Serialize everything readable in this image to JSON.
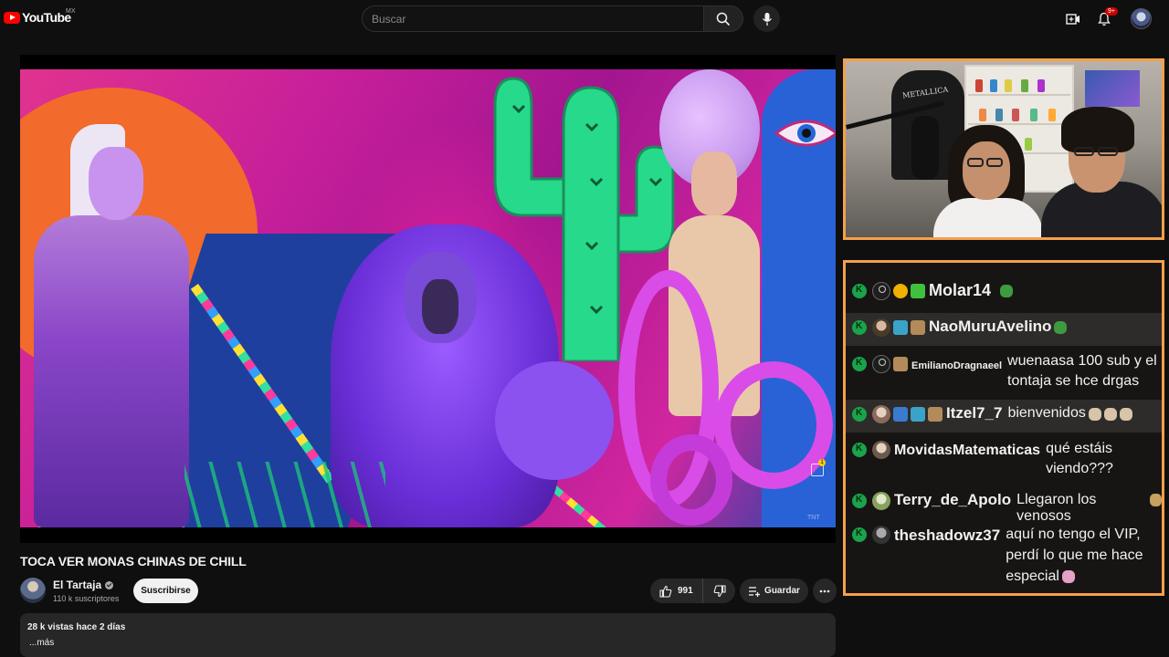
{
  "header": {
    "logo_text": "YouTube",
    "region": "MX",
    "search_placeholder": "Buscar",
    "notifications_count": "9+",
    "icons": [
      "youtube-logo-icon",
      "search-icon",
      "microphone-icon",
      "create-video-icon",
      "bell-icon",
      "avatar"
    ]
  },
  "video": {
    "title": "TOCA VER MONAS CHINAS DE CHILL",
    "channel": "El Tartaja",
    "subscribers": "110 k suscriptores",
    "subscribe_label": "Suscribirse",
    "likes": "991",
    "save_label": "Guardar",
    "views_date": "28 k vistas  hace 2 días",
    "more_label": "...más",
    "watermark": "TNT"
  },
  "webcam": {
    "jacket_text": "METALLICA"
  },
  "chat": {
    "accent_color": "#f5a04a",
    "mod_color": "#1aa34a",
    "messages": [
      {
        "user": "Molar14",
        "text": "",
        "highlight": false
      },
      {
        "user": "NaoMuruAvelino",
        "text": "",
        "highlight": true
      },
      {
        "user": "EmilianoDragnaeel",
        "text": "wuenaasa 100 sub y el tontaja se hce drgas",
        "highlight": false
      },
      {
        "user": "Itzel7_7",
        "text": "bienvenidos",
        "highlight": true
      },
      {
        "user": "MovidasMatematicas",
        "text": "qué estáis viendo???",
        "highlight": false
      },
      {
        "user": "Terry_de_Apolo",
        "text": "Llegaron los venosos",
        "highlight": false
      },
      {
        "user": "theshadowz37",
        "text": "aquí no tengo el VIP, perdí lo que me hace especial",
        "highlight": false
      }
    ]
  }
}
